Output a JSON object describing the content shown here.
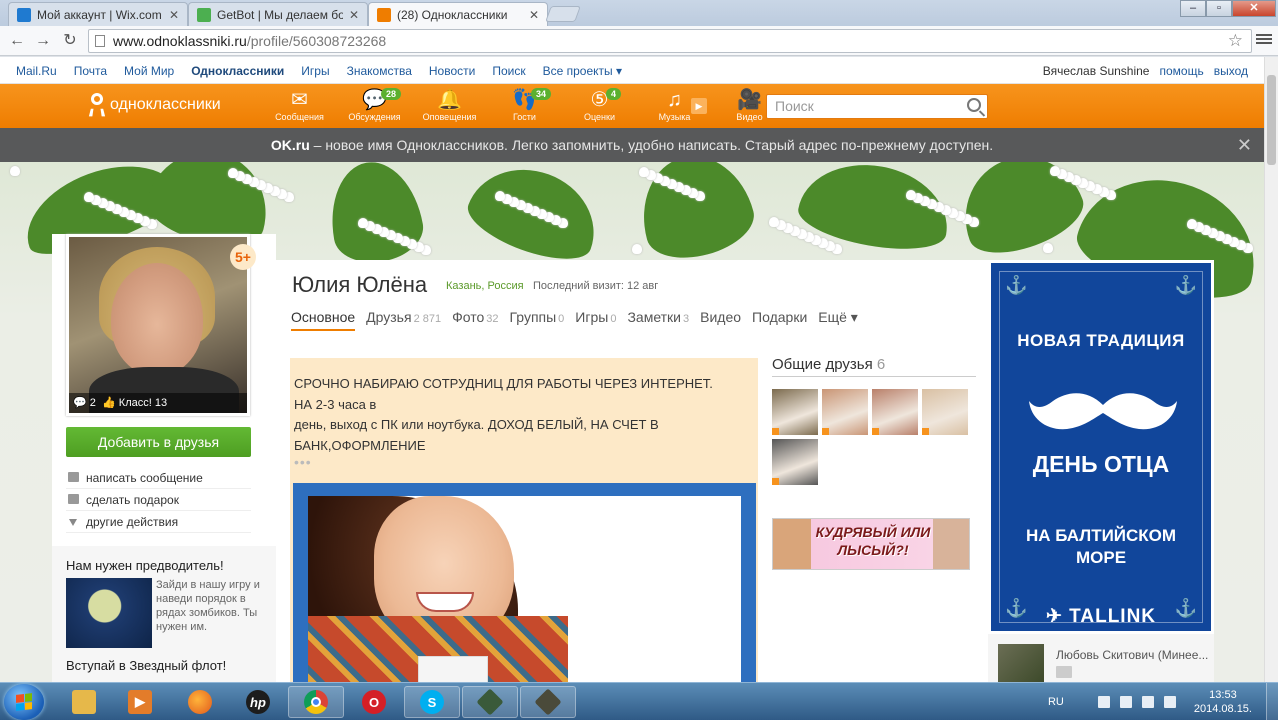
{
  "browser": {
    "tabs": [
      {
        "title": "Мой аккаунт | Wix.com",
        "favicon_color": "#1f7ad0"
      },
      {
        "title": "GetBot | Мы делаем бота",
        "favicon_color": "#4caf50"
      },
      {
        "title": "(28) Одноклассники",
        "favicon_color": "#ef7d00"
      }
    ],
    "url_host": "www.odnoklassniki.ru",
    "url_path": "/profile/560308723268"
  },
  "portal": {
    "links": [
      "Mail.Ru",
      "Почта",
      "Мой Мир",
      "Одноклассники",
      "Игры",
      "Знакомства",
      "Новости",
      "Поиск",
      "Все проекты ▾"
    ],
    "user_name": "Вячеслав Sunshine",
    "help": "помощь",
    "logout": "выход"
  },
  "ok_header": {
    "logo_text": "одноклассники",
    "nav": [
      {
        "label": "Сообщения",
        "icon": "envelope-icon",
        "glyph": "✉",
        "badge": ""
      },
      {
        "label": "Обсуждения",
        "icon": "discussions-icon",
        "glyph": "💬",
        "badge": "28"
      },
      {
        "label": "Оповещения",
        "icon": "bell-icon",
        "glyph": "🔔",
        "badge": ""
      },
      {
        "label": "Гости",
        "icon": "footprints-icon",
        "glyph": "👣",
        "badge": "34"
      },
      {
        "label": "Оценки",
        "icon": "rating-icon",
        "glyph": "⑤",
        "badge": "4"
      },
      {
        "label": "Музыка",
        "icon": "music-icon",
        "glyph": "♫",
        "badge": ""
      },
      {
        "label": "Видео",
        "icon": "video-camera-icon",
        "glyph": "🎥",
        "badge": ""
      }
    ],
    "search_placeholder": "Поиск"
  },
  "notice": {
    "brand": "OK.ru",
    "text": " – новое имя Одноклассников. Легко запомнить, удобно написать. Старый адрес по-прежнему доступен."
  },
  "profile": {
    "name": "Юлия Юлёна",
    "location": "Казань, Россия",
    "last_visit": "Последний визит: 12 авг",
    "age_badge": "5+",
    "comments_count": "2",
    "class_label": "Класс! 13",
    "add_friend": "Добавить в друзья",
    "actions": [
      "написать сообщение",
      "сделать подарок",
      "другие действия"
    ],
    "tabs": [
      {
        "label": "Основное",
        "count": ""
      },
      {
        "label": "Друзья",
        "count": "2 871"
      },
      {
        "label": "Фото",
        "count": "32"
      },
      {
        "label": "Группы",
        "count": "0"
      },
      {
        "label": "Игры",
        "count": "0"
      },
      {
        "label": "Заметки",
        "count": "3"
      },
      {
        "label": "Видео",
        "count": ""
      },
      {
        "label": "Подарки",
        "count": ""
      },
      {
        "label": "Ещё ▾",
        "count": ""
      }
    ],
    "status_lines": [
      "СРОЧНО НАБИРАЮ СОТРУДНИЦ ДЛЯ РАБОТЫ ЧЕРЕЗ ИНТЕРНЕТ.",
      "НА 2-3 часа в",
      "день, выход с ПК или ноутбука. ДОХОД БЕЛЫЙ, НА  СЧЕТ В",
      "БАНК,ОФОРМЛЕНИЕ"
    ],
    "status_more": "•••"
  },
  "mutual_friends": {
    "title": "Общие друзья",
    "count": "6",
    "thumb_colors": [
      "#7b6a4d",
      "#c99575",
      "#b9806a",
      "#d9c0a3",
      "#555555"
    ]
  },
  "ad_small": {
    "text": "КУДРЯВЫЙ ИЛИ ЛЫСЫЙ?!"
  },
  "sidebar_promo": {
    "title": "Нам нужен предводитель!",
    "text": "Зайди в нашу игру и наведи порядок в рядах зомбиков. Ты нужен им.",
    "title2": "Вступай в Звездный флот!"
  },
  "right_ad": {
    "line1": "НОВАЯ ТРАДИЦИЯ",
    "line2": "ДЕНЬ ОТЦА",
    "line3a": "НА БАЛТИЙСКОМ",
    "line3b": "МОРЕ",
    "brand": "TALLINK"
  },
  "friend_item": {
    "name": "Любовь Скитович (Минее..."
  },
  "taskbar": {
    "lang": "RU",
    "time": "13:53",
    "date": "2014.08.15."
  }
}
